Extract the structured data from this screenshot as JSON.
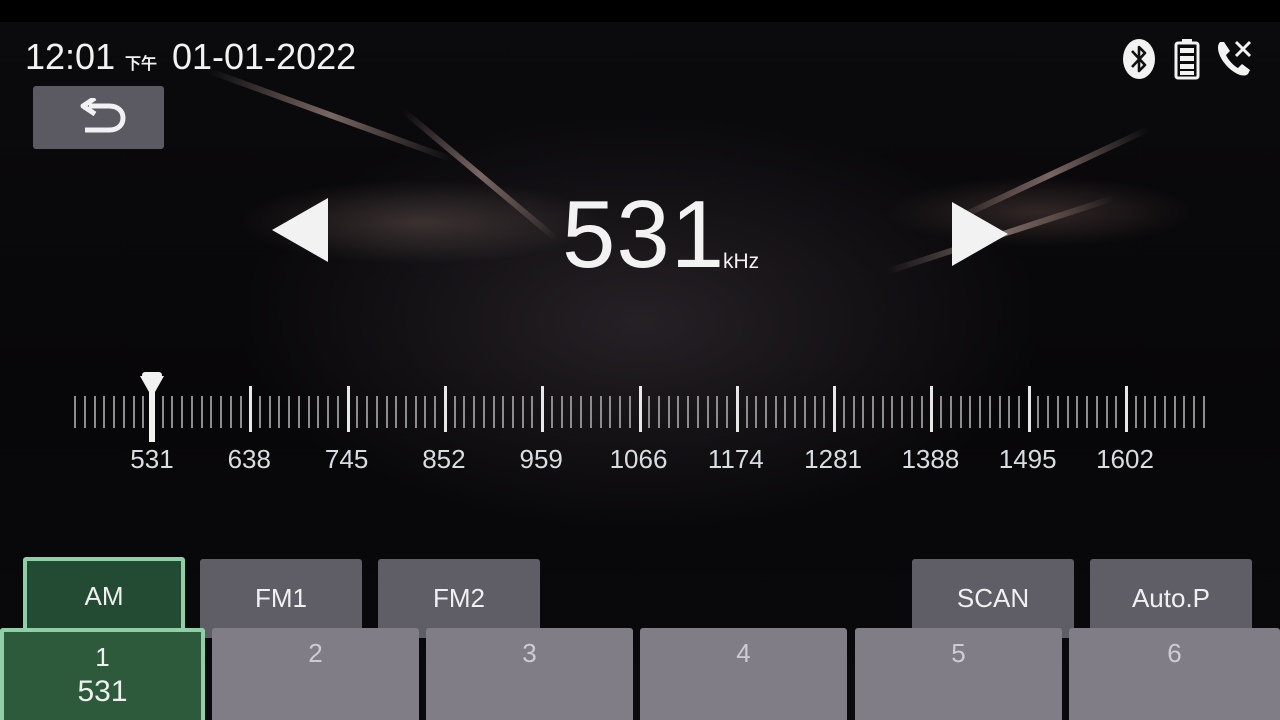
{
  "status": {
    "time": "12:01",
    "ampm": "下午",
    "date": "01-01-2022",
    "icons": [
      "bluetooth-icon",
      "battery-icon",
      "phone-icon"
    ]
  },
  "tuner": {
    "frequency": "531",
    "unit": "kHz"
  },
  "dial": {
    "labels": [
      "531",
      "638",
      "745",
      "852",
      "959",
      "1066",
      "1174",
      "1281",
      "1388",
      "1495",
      "1602"
    ],
    "current_value": 531
  },
  "bands": {
    "am": "AM",
    "fm1": "FM1",
    "fm2": "FM2",
    "active": "AM"
  },
  "actions": {
    "scan": "SCAN",
    "auto_preset": "Auto.P"
  },
  "presets": [
    {
      "number": "1",
      "frequency": "531"
    },
    {
      "number": "2",
      "frequency": ""
    },
    {
      "number": "3",
      "frequency": ""
    },
    {
      "number": "4",
      "frequency": ""
    },
    {
      "number": "5",
      "frequency": ""
    },
    {
      "number": "6",
      "frequency": ""
    }
  ],
  "colors": {
    "active_band": "#234a33",
    "active_border": "#8fcfa8",
    "button": "#5f5d66"
  }
}
